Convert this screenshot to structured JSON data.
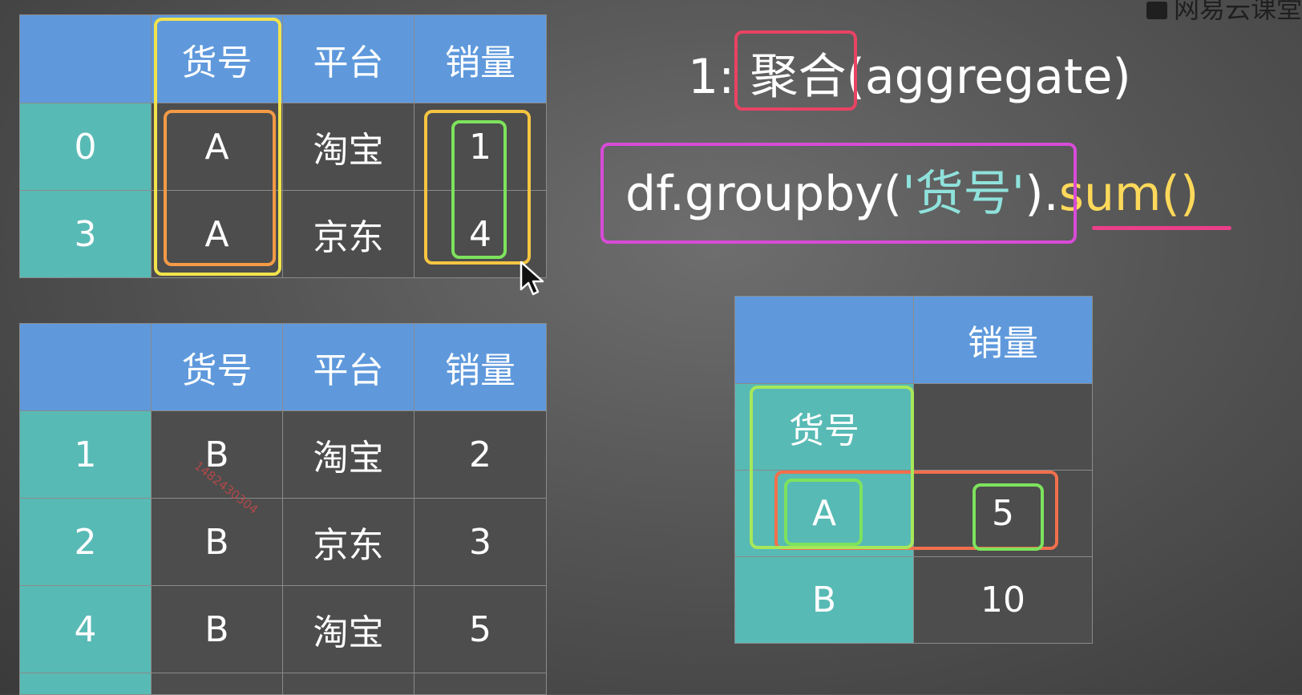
{
  "watermark": {
    "top_right": "网易云课堂",
    "diagonal": "1482430304"
  },
  "table_top": {
    "headers": [
      "",
      "货号",
      "平台",
      "销量"
    ],
    "rows": [
      [
        "0",
        "A",
        "淘宝",
        "1"
      ],
      [
        "3",
        "A",
        "京东",
        "4"
      ]
    ]
  },
  "table_bottom": {
    "headers": [
      "",
      "货号",
      "平台",
      "销量"
    ],
    "rows": [
      [
        "1",
        "B",
        "淘宝",
        "2"
      ],
      [
        "2",
        "B",
        "京东",
        "3"
      ],
      [
        "4",
        "B",
        "淘宝",
        "5"
      ]
    ]
  },
  "heading": {
    "number": "1:",
    "term": "聚合",
    "english": "(aggregate)"
  },
  "code": {
    "prefix": "df.groupby(",
    "arg": "'货号'",
    "close": ")",
    "dot": ".",
    "method": "sum()"
  },
  "result_table": {
    "header_value": "销量",
    "index_name": "货号",
    "rows": [
      [
        "A",
        "5"
      ],
      [
        "B",
        "10"
      ]
    ]
  },
  "colors": {
    "header_blue": "#5f99dc",
    "index_teal": "#58bab5",
    "cell_gray": "#4d4d4d",
    "highlight_yellow": "#f2e34c",
    "highlight_orange": "#f59a45",
    "highlight_green": "#7de35c",
    "highlight_red": "#e84363",
    "highlight_magenta": "#d84bd8",
    "code_teal": "#8fe2dc",
    "code_yellow": "#ffd95a",
    "underline_pink": "#ea3f8a"
  }
}
